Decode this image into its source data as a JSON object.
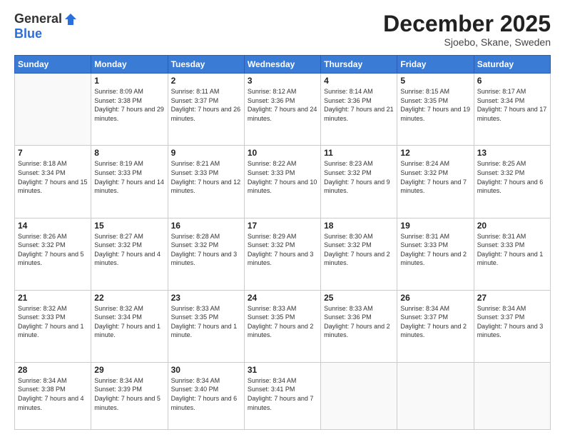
{
  "header": {
    "logo_general": "General",
    "logo_blue": "Blue",
    "month_title": "December 2025",
    "location": "Sjoebo, Skane, Sweden"
  },
  "weekdays": [
    "Sunday",
    "Monday",
    "Tuesday",
    "Wednesday",
    "Thursday",
    "Friday",
    "Saturday"
  ],
  "weeks": [
    [
      {
        "num": "",
        "sunrise": "",
        "sunset": "",
        "daylight": ""
      },
      {
        "num": "1",
        "sunrise": "Sunrise: 8:09 AM",
        "sunset": "Sunset: 3:38 PM",
        "daylight": "Daylight: 7 hours and 29 minutes."
      },
      {
        "num": "2",
        "sunrise": "Sunrise: 8:11 AM",
        "sunset": "Sunset: 3:37 PM",
        "daylight": "Daylight: 7 hours and 26 minutes."
      },
      {
        "num": "3",
        "sunrise": "Sunrise: 8:12 AM",
        "sunset": "Sunset: 3:36 PM",
        "daylight": "Daylight: 7 hours and 24 minutes."
      },
      {
        "num": "4",
        "sunrise": "Sunrise: 8:14 AM",
        "sunset": "Sunset: 3:36 PM",
        "daylight": "Daylight: 7 hours and 21 minutes."
      },
      {
        "num": "5",
        "sunrise": "Sunrise: 8:15 AM",
        "sunset": "Sunset: 3:35 PM",
        "daylight": "Daylight: 7 hours and 19 minutes."
      },
      {
        "num": "6",
        "sunrise": "Sunrise: 8:17 AM",
        "sunset": "Sunset: 3:34 PM",
        "daylight": "Daylight: 7 hours and 17 minutes."
      }
    ],
    [
      {
        "num": "7",
        "sunrise": "Sunrise: 8:18 AM",
        "sunset": "Sunset: 3:34 PM",
        "daylight": "Daylight: 7 hours and 15 minutes."
      },
      {
        "num": "8",
        "sunrise": "Sunrise: 8:19 AM",
        "sunset": "Sunset: 3:33 PM",
        "daylight": "Daylight: 7 hours and 14 minutes."
      },
      {
        "num": "9",
        "sunrise": "Sunrise: 8:21 AM",
        "sunset": "Sunset: 3:33 PM",
        "daylight": "Daylight: 7 hours and 12 minutes."
      },
      {
        "num": "10",
        "sunrise": "Sunrise: 8:22 AM",
        "sunset": "Sunset: 3:33 PM",
        "daylight": "Daylight: 7 hours and 10 minutes."
      },
      {
        "num": "11",
        "sunrise": "Sunrise: 8:23 AM",
        "sunset": "Sunset: 3:32 PM",
        "daylight": "Daylight: 7 hours and 9 minutes."
      },
      {
        "num": "12",
        "sunrise": "Sunrise: 8:24 AM",
        "sunset": "Sunset: 3:32 PM",
        "daylight": "Daylight: 7 hours and 7 minutes."
      },
      {
        "num": "13",
        "sunrise": "Sunrise: 8:25 AM",
        "sunset": "Sunset: 3:32 PM",
        "daylight": "Daylight: 7 hours and 6 minutes."
      }
    ],
    [
      {
        "num": "14",
        "sunrise": "Sunrise: 8:26 AM",
        "sunset": "Sunset: 3:32 PM",
        "daylight": "Daylight: 7 hours and 5 minutes."
      },
      {
        "num": "15",
        "sunrise": "Sunrise: 8:27 AM",
        "sunset": "Sunset: 3:32 PM",
        "daylight": "Daylight: 7 hours and 4 minutes."
      },
      {
        "num": "16",
        "sunrise": "Sunrise: 8:28 AM",
        "sunset": "Sunset: 3:32 PM",
        "daylight": "Daylight: 7 hours and 3 minutes."
      },
      {
        "num": "17",
        "sunrise": "Sunrise: 8:29 AM",
        "sunset": "Sunset: 3:32 PM",
        "daylight": "Daylight: 7 hours and 3 minutes."
      },
      {
        "num": "18",
        "sunrise": "Sunrise: 8:30 AM",
        "sunset": "Sunset: 3:32 PM",
        "daylight": "Daylight: 7 hours and 2 minutes."
      },
      {
        "num": "19",
        "sunrise": "Sunrise: 8:31 AM",
        "sunset": "Sunset: 3:33 PM",
        "daylight": "Daylight: 7 hours and 2 minutes."
      },
      {
        "num": "20",
        "sunrise": "Sunrise: 8:31 AM",
        "sunset": "Sunset: 3:33 PM",
        "daylight": "Daylight: 7 hours and 1 minute."
      }
    ],
    [
      {
        "num": "21",
        "sunrise": "Sunrise: 8:32 AM",
        "sunset": "Sunset: 3:33 PM",
        "daylight": "Daylight: 7 hours and 1 minute."
      },
      {
        "num": "22",
        "sunrise": "Sunrise: 8:32 AM",
        "sunset": "Sunset: 3:34 PM",
        "daylight": "Daylight: 7 hours and 1 minute."
      },
      {
        "num": "23",
        "sunrise": "Sunrise: 8:33 AM",
        "sunset": "Sunset: 3:35 PM",
        "daylight": "Daylight: 7 hours and 1 minute."
      },
      {
        "num": "24",
        "sunrise": "Sunrise: 8:33 AM",
        "sunset": "Sunset: 3:35 PM",
        "daylight": "Daylight: 7 hours and 2 minutes."
      },
      {
        "num": "25",
        "sunrise": "Sunrise: 8:33 AM",
        "sunset": "Sunset: 3:36 PM",
        "daylight": "Daylight: 7 hours and 2 minutes."
      },
      {
        "num": "26",
        "sunrise": "Sunrise: 8:34 AM",
        "sunset": "Sunset: 3:37 PM",
        "daylight": "Daylight: 7 hours and 2 minutes."
      },
      {
        "num": "27",
        "sunrise": "Sunrise: 8:34 AM",
        "sunset": "Sunset: 3:37 PM",
        "daylight": "Daylight: 7 hours and 3 minutes."
      }
    ],
    [
      {
        "num": "28",
        "sunrise": "Sunrise: 8:34 AM",
        "sunset": "Sunset: 3:38 PM",
        "daylight": "Daylight: 7 hours and 4 minutes."
      },
      {
        "num": "29",
        "sunrise": "Sunrise: 8:34 AM",
        "sunset": "Sunset: 3:39 PM",
        "daylight": "Daylight: 7 hours and 5 minutes."
      },
      {
        "num": "30",
        "sunrise": "Sunrise: 8:34 AM",
        "sunset": "Sunset: 3:40 PM",
        "daylight": "Daylight: 7 hours and 6 minutes."
      },
      {
        "num": "31",
        "sunrise": "Sunrise: 8:34 AM",
        "sunset": "Sunset: 3:41 PM",
        "daylight": "Daylight: 7 hours and 7 minutes."
      },
      {
        "num": "",
        "sunrise": "",
        "sunset": "",
        "daylight": ""
      },
      {
        "num": "",
        "sunrise": "",
        "sunset": "",
        "daylight": ""
      },
      {
        "num": "",
        "sunrise": "",
        "sunset": "",
        "daylight": ""
      }
    ]
  ]
}
